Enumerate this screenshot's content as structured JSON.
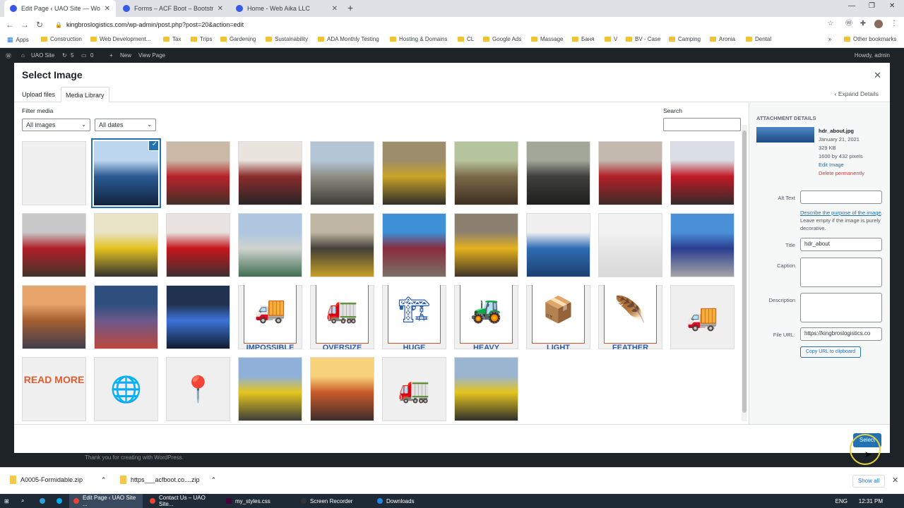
{
  "browser": {
    "tabs": [
      {
        "title": "Edit Page ‹ UAO Site — WordPre",
        "active": true
      },
      {
        "title": "Forms – ACF Boot – Bootstrap M",
        "active": false
      },
      {
        "title": "Home - Web Aika LLC",
        "active": false
      }
    ],
    "url": "kingbroslogistics.com/wp-admin/post.php?post=20&action=edit",
    "bookmarks": [
      "Apps",
      "Construction",
      "Web Development...",
      "Tax",
      "Trips",
      "Gardening",
      "Sustainability",
      "ADA Monthly Testing",
      "Hosting & Domains",
      "CL",
      "Google Ads",
      "Massage",
      "Баня",
      "V",
      "BV - Case",
      "Camping",
      "Aronia",
      "Dental"
    ],
    "other_bookmarks": "Other bookmarks"
  },
  "admin_bar": {
    "site": "UAO Site",
    "updates": "5",
    "comments": "0",
    "new": "New",
    "view": "View Page",
    "howdy": "Howdy, admin"
  },
  "modal": {
    "title": "Select Image",
    "tabs": [
      "Upload files",
      "Media Library"
    ],
    "filter_label": "Filter media",
    "filter_type": "All images",
    "filter_date": "All dates",
    "search_label": "Search",
    "select_button": "Select",
    "items": [
      {
        "kind": "blank"
      },
      {
        "kind": "photo",
        "colors": [
          "#bcd6ef",
          "#2a5a93",
          "#11233f"
        ],
        "selected": true
      },
      {
        "kind": "photo",
        "colors": [
          "#c9b9a6",
          "#b7222a",
          "#403028"
        ]
      },
      {
        "kind": "photo",
        "colors": [
          "#e9e4dd",
          "#8a2b2b",
          "#262626"
        ]
      },
      {
        "kind": "photo",
        "colors": [
          "#b4c6d6",
          "#8d8d83",
          "#3a3a36"
        ]
      },
      {
        "kind": "photo",
        "colors": [
          "#9e8d6a",
          "#c9a227",
          "#2b2b2b"
        ]
      },
      {
        "kind": "photo",
        "colors": [
          "#b6c49e",
          "#7b6a48",
          "#3b2e20"
        ]
      },
      {
        "kind": "photo",
        "colors": [
          "#a1a89a",
          "#3f3f3b",
          "#1d1d1d"
        ]
      },
      {
        "kind": "photo",
        "colors": [
          "#c3b9ae",
          "#b31f28",
          "#3a2d28"
        ]
      },
      {
        "kind": "photo",
        "colors": [
          "#d9dde4",
          "#c11a26",
          "#2f2b2b"
        ]
      },
      {
        "kind": "photo",
        "colors": [
          "#c8c8c8",
          "#b01e26",
          "#40362a"
        ]
      },
      {
        "kind": "photo",
        "colors": [
          "#e9e4c8",
          "#e3c21f",
          "#2f2f2f"
        ]
      },
      {
        "kind": "photo",
        "colors": [
          "#e8e3e0",
          "#c4161d",
          "#3a3030"
        ]
      },
      {
        "kind": "photo",
        "colors": [
          "#aec6e0",
          "#cfd3cf",
          "#3d6b4f"
        ]
      },
      {
        "kind": "photo",
        "colors": [
          "#bfb7a3",
          "#434037",
          "#c9a227"
        ]
      },
      {
        "kind": "photo",
        "colors": [
          "#3d8fd6",
          "#8a2c3d",
          "#7a7266"
        ]
      },
      {
        "kind": "photo",
        "colors": [
          "#8c8170",
          "#e5b21d",
          "#3b3127"
        ]
      },
      {
        "kind": "photo",
        "colors": [
          "#f0f0f0",
          "#2e6cb3",
          "#1c3f6e"
        ]
      },
      {
        "kind": "photo",
        "colors": [
          "#f2f2f2",
          "#e6e6e6",
          "#d9d9d9"
        ]
      },
      {
        "kind": "photo",
        "colors": [
          "#4a90d8",
          "#2a3d8f",
          "#a8a8a8"
        ]
      },
      {
        "kind": "photo",
        "colors": [
          "#e6a36a",
          "#a55f32",
          "#3d3d4d"
        ]
      },
      {
        "kind": "photo",
        "colors": [
          "#2f4f7f",
          "#6b5a8a",
          "#c0463c"
        ]
      },
      {
        "kind": "photo",
        "colors": [
          "#20324f",
          "#3d73d9",
          "#0f1a2b"
        ]
      },
      {
        "kind": "icon",
        "glyph": "🚚",
        "caption": "IMPOSSIBLE"
      },
      {
        "kind": "icon",
        "glyph": "🚛",
        "caption": "OVERSIZE"
      },
      {
        "kind": "icon",
        "glyph": "🏗",
        "caption": "HUGE"
      },
      {
        "kind": "icon",
        "glyph": "🚜",
        "caption": "HEAVY"
      },
      {
        "kind": "icon",
        "glyph": "📦",
        "caption": "LIGHT"
      },
      {
        "kind": "icon",
        "glyph": "🪶",
        "caption": "FEATHER"
      },
      {
        "kind": "plain-icon",
        "glyph": "🚚"
      },
      {
        "kind": "readmore",
        "text": "READ MORE"
      },
      {
        "kind": "plain-icon",
        "glyph": "🌐"
      },
      {
        "kind": "plain-icon",
        "glyph": "📍"
      },
      {
        "kind": "photo",
        "colors": [
          "#8fb0d8",
          "#e5c51f",
          "#3a3a3a"
        ]
      },
      {
        "kind": "photo",
        "colors": [
          "#f6d27a",
          "#c85b2a",
          "#3a2b2b"
        ]
      },
      {
        "kind": "plain-icon",
        "glyph": "🚛"
      },
      {
        "kind": "photo",
        "colors": [
          "#9bb4d0",
          "#e5c51f",
          "#2b2b2b"
        ]
      }
    ]
  },
  "details": {
    "heading": "Attachment Details",
    "expand": "Expand Details",
    "filename": "hdr_about.jpg",
    "date": "January 21, 2021",
    "size": "329 KB",
    "dimensions": "1600 by 432 pixels",
    "edit_link": "Edit Image",
    "delete_link": "Delete permanently",
    "alt_label": "Alt Text",
    "alt_value": "",
    "describe_link": "Describe the purpose of the image",
    "describe_rest": ". Leave empty if the image is purely decorative.",
    "title_label": "Title",
    "title_value": "hdr_about",
    "caption_label": "Caption",
    "description_label": "Description",
    "url_label": "File URL:",
    "url_value": "https://kingbroslogistics.co",
    "copy_button": "Copy URL to clipboard"
  },
  "footer_text": "Thank you for creating with WordPress.",
  "downloads": {
    "items": [
      "A0005-Formidable.zip",
      "https___acfboot.co....zip"
    ],
    "show_all": "Show all"
  },
  "taskbar": {
    "apps": [
      "Edit Page ‹ UAO Site ...",
      "Contact Us – UAO Site...",
      "my_styles.css",
      "Screen Recorder",
      "Downloads"
    ],
    "lang": "ENG",
    "time": "12:31 PM"
  }
}
